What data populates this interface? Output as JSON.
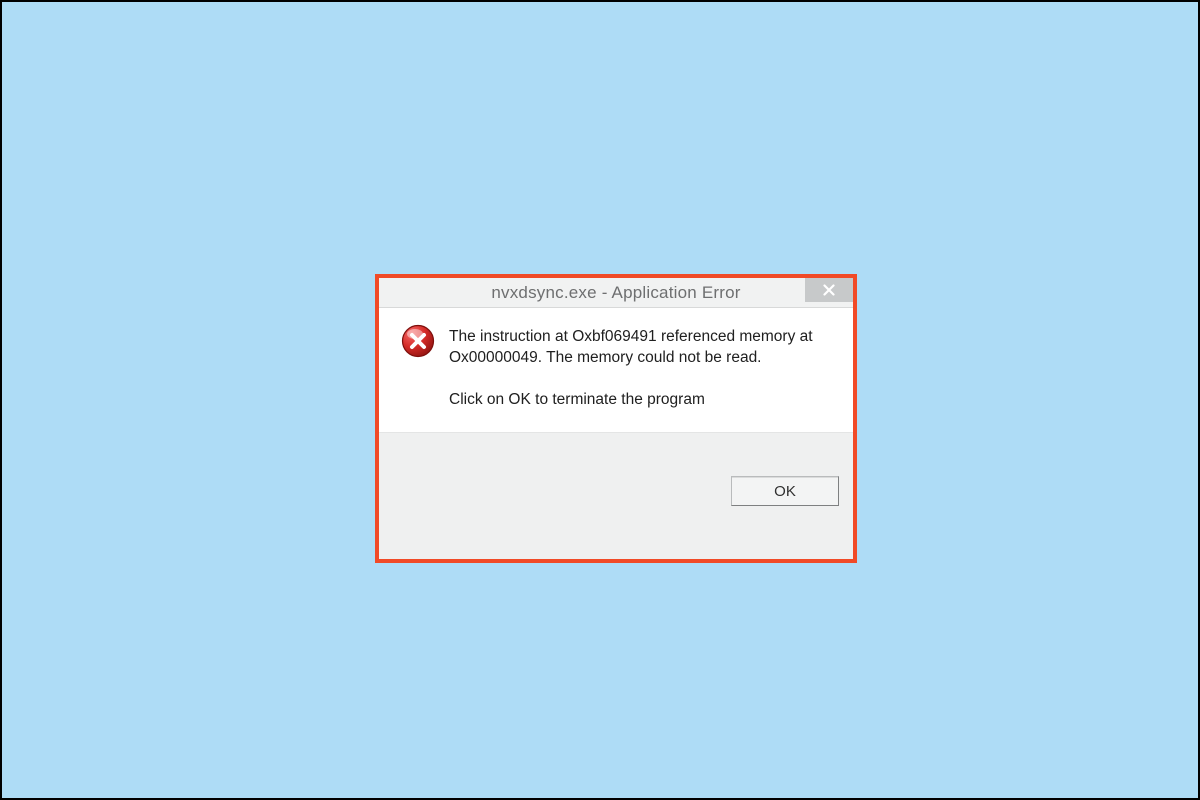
{
  "dialog": {
    "title": "nvxdsync.exe - Application Error",
    "message_primary": "The instruction at Oxbf069491 referenced memory at Ox00000049. The memory could not be read.",
    "message_secondary": "Click on OK to terminate the program",
    "ok_label": "OK"
  }
}
